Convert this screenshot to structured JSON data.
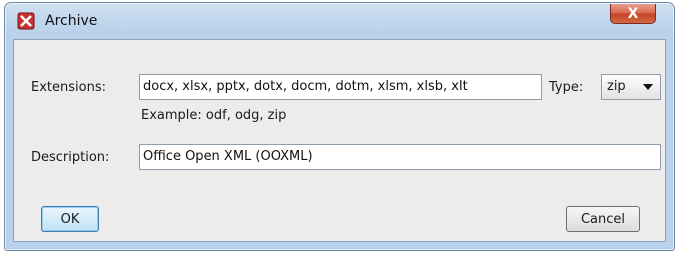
{
  "window": {
    "title": "Archive",
    "close_symbol": "X"
  },
  "form": {
    "extensions_label": "Extensions:",
    "extensions_value": "docx, xlsx, pptx, dotx, docm, dotm, xlsm, xlsb, xlt",
    "example_text": "Example: odf, odg, zip",
    "type_label": "Type:",
    "type_value": "zip",
    "description_label": "Description:",
    "description_value": "Office Open XML (OOXML)"
  },
  "buttons": {
    "ok": "OK",
    "cancel": "Cancel"
  },
  "icons": {
    "app": "archive-app-icon",
    "close": "close-icon",
    "dropdown": "chevron-down-icon"
  },
  "colors": {
    "close_button": "#c54327",
    "title_bar": "#b9d1ea",
    "app_icon": "#c73131"
  }
}
